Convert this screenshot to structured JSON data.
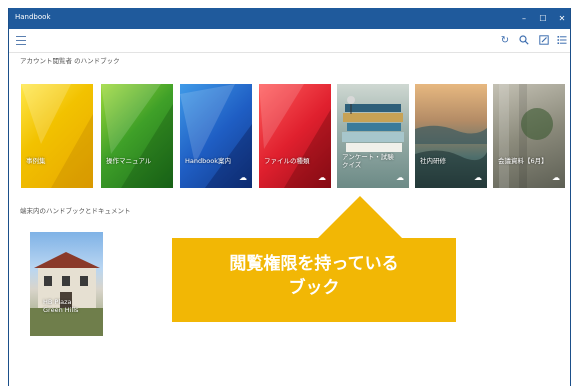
{
  "window": {
    "title": "Handbook",
    "controls": {
      "minimize": "–",
      "maximize": "☐",
      "close": "✕"
    }
  },
  "toolbar": {
    "icons": [
      "refresh-icon",
      "search-icon",
      "edit-icon",
      "list-icon"
    ]
  },
  "sections": {
    "account_handbooks": "アカウント閲覧者 のハンドブック",
    "device_handbooks": "端末内のハンドブックとドキュメント"
  },
  "tiles": [
    {
      "label": "事例集",
      "color": "#f2c200"
    },
    {
      "label": "操作マニュアル",
      "color": "#3fa028"
    },
    {
      "label": "Handbook案内",
      "color": "#1f5ec4"
    },
    {
      "label": "ファイルの種類",
      "color": "#e0202e"
    },
    {
      "label": "アンケート・試験\nクイズ",
      "color": "#9fb3ae"
    },
    {
      "label": "社内研修",
      "color": "#b48c66"
    },
    {
      "label": "会議資料【6月】",
      "color": "#8b8a7b"
    }
  ],
  "documents": [
    {
      "label": "HB Plaza\nGreen Hills"
    }
  ],
  "callout": {
    "line1": "閲覧権限を持っている",
    "line2": "ブック",
    "color": "#f2b705"
  }
}
